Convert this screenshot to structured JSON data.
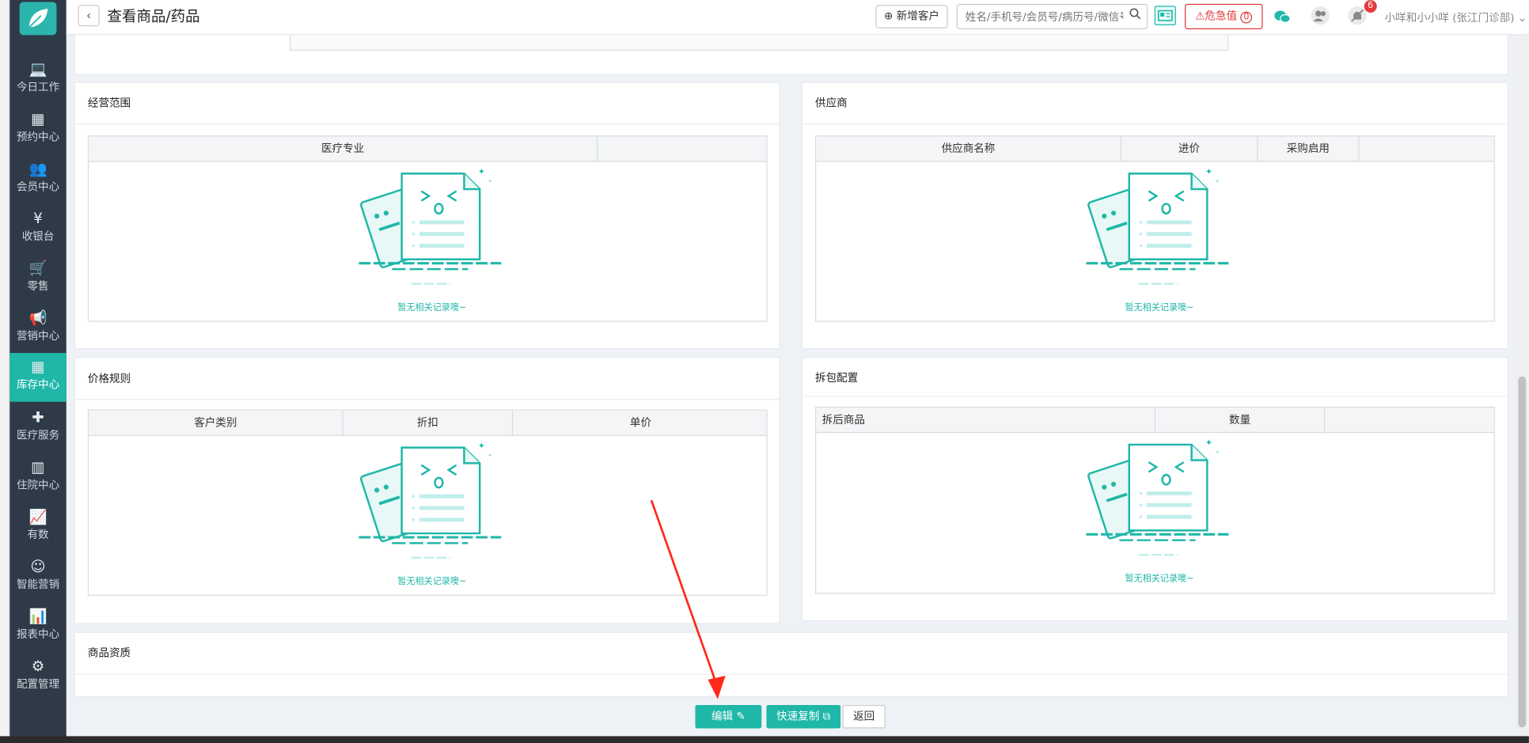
{
  "sidebar": {
    "items": [
      {
        "icon": "laptop-icon",
        "label": "今日工作"
      },
      {
        "icon": "calendar-icon",
        "label": "预约中心"
      },
      {
        "icon": "users-icon",
        "label": "会员中心"
      },
      {
        "icon": "yen-icon",
        "label": "收银台"
      },
      {
        "icon": "cart-icon",
        "label": "零售"
      },
      {
        "icon": "megaphone-icon",
        "label": "营销中心"
      },
      {
        "icon": "grid-icon",
        "label": "库存中心",
        "active": true
      },
      {
        "icon": "medkit-icon",
        "label": "医疗服务"
      },
      {
        "icon": "building-icon",
        "label": "住院中心"
      },
      {
        "icon": "line-chart-icon",
        "label": "有数"
      },
      {
        "icon": "robot-icon",
        "label": "智能营销"
      },
      {
        "icon": "bar-chart-icon",
        "label": "报表中心"
      },
      {
        "icon": "gear-icon",
        "label": "配置管理"
      }
    ],
    "glyphs": [
      "💻",
      "▦",
      "👥",
      "¥",
      "🛒",
      "📢",
      "▦",
      "✚",
      "▥",
      "📈",
      "☺",
      "📊",
      "⚙"
    ]
  },
  "header": {
    "back": "‹",
    "title": "查看商品/药品",
    "new_customer": "新增客户",
    "search_placeholder": "姓名/手机号/会员号/病历号/微信号",
    "critical": "危急值",
    "critical_count": "0",
    "bell_badge": "6",
    "user": "小咩和小小咩 (张江门诊部)"
  },
  "colors": {
    "accent": "#1fb7a8",
    "sidebar": "#2e3a47",
    "danger": "#e03a3a"
  },
  "panels": {
    "business_scope": {
      "title": "经营范围",
      "columns": [
        "医疗专业",
        ""
      ],
      "empty": "暂无相关记录噢~"
    },
    "supplier": {
      "title": "供应商",
      "columns": [
        "供应商名称",
        "进价",
        "采购启用",
        ""
      ],
      "empty": "暂无相关记录噢~"
    },
    "price_rules": {
      "title": "价格规则",
      "columns": [
        "客户类别",
        "折扣",
        "单价"
      ],
      "empty": "暂无相关记录噢~"
    },
    "split_config": {
      "title": "拆包配置",
      "columns": [
        "拆后商品",
        "数量",
        ""
      ],
      "empty": "暂无相关记录噢~"
    },
    "qualification": {
      "title": "商品资质"
    }
  },
  "actions": {
    "edit": "编辑",
    "quick_copy": "快速复制",
    "back": "返回"
  }
}
